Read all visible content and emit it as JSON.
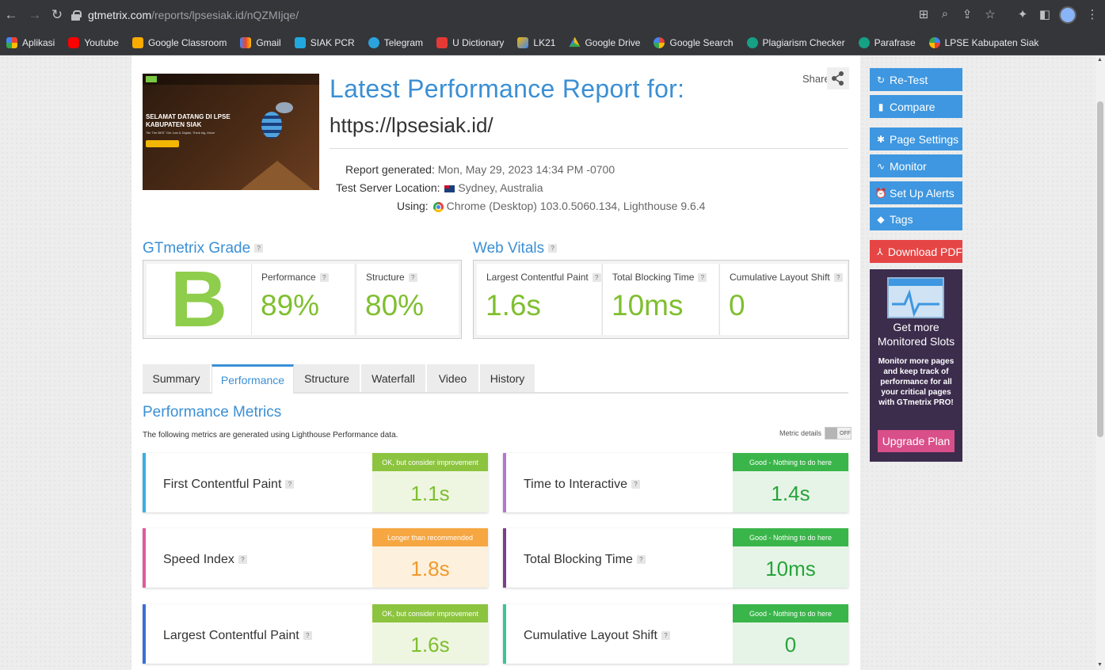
{
  "browser": {
    "url_host": "gtmetrix.com",
    "url_path": "/reports/lpsesiak.id/nQZMIjqe/",
    "bookmarks": [
      {
        "label": "Aplikasi",
        "color": "#e8453c"
      },
      {
        "label": "Youtube",
        "color": "#ff0000"
      },
      {
        "label": "Google Classroom",
        "color": "#f9ab00"
      },
      {
        "label": "Gmail",
        "color": "#ea4335"
      },
      {
        "label": "SIAK PCR",
        "color": "#21a8e0"
      },
      {
        "label": "Telegram",
        "color": "#2aa3de"
      },
      {
        "label": "U Dictionary",
        "color": "#e53935"
      },
      {
        "label": "LK21",
        "color": "#f4b400"
      },
      {
        "label": "Google Drive",
        "color": "#34a853"
      },
      {
        "label": "Google Search",
        "color": "#4285f4"
      },
      {
        "label": "Plagiarism Checker",
        "color": "#16a085"
      },
      {
        "label": "Parafrase",
        "color": "#16a085"
      },
      {
        "label": "LPSE Kabupaten Siak",
        "color": "#4285f4"
      }
    ]
  },
  "thumbnail": {
    "title": "SELAMAT DATANG DI LPSE KABUPATEN SIAK",
    "subtitle": "\"Be The BEE\" Get Just & Digital, Think big, Move"
  },
  "report": {
    "title": "Latest Performance Report for:",
    "url": "https://lpsesiak.id/",
    "share_label": "Share",
    "generated_label": "Report generated:",
    "generated_value": "Mon, May 29, 2023 14:34 PM -0700",
    "location_label": "Test Server Location:",
    "location_value": "Sydney, Australia",
    "using_label": "Using:",
    "using_value": "Chrome (Desktop) 103.0.5060.134, Lighthouse 9.6.4"
  },
  "grade": {
    "title": "GTmetrix Grade",
    "letter": "B",
    "performance_label": "Performance",
    "performance_value": "89%",
    "structure_label": "Structure",
    "structure_value": "80%"
  },
  "web_vitals": {
    "title": "Web Vitals",
    "items": [
      {
        "label": "Largest Contentful Paint",
        "value": "1.6s"
      },
      {
        "label": "Total Blocking Time",
        "value": "10ms"
      },
      {
        "label": "Cumulative Layout Shift",
        "value": "0"
      }
    ]
  },
  "tabs": [
    "Summary",
    "Performance",
    "Structure",
    "Waterfall",
    "Video",
    "History"
  ],
  "metrics_section": {
    "title": "Performance Metrics",
    "description": "The following metrics are generated using Lighthouse Performance data.",
    "metric_details_label": "Metric details",
    "toggle_state": "OFF"
  },
  "metrics": [
    {
      "label": "First Contentful Paint",
      "badge": "OK, but consider improvement",
      "value": "1.1s",
      "stripe": "#3aaee3",
      "badge_color": "#8cc43f",
      "bg": "#eef6e1",
      "text_color": "#7fbf2f"
    },
    {
      "label": "Time to Interactive",
      "badge": "Good - Nothing to do here",
      "value": "1.4s",
      "stripe": "#b376d6",
      "badge_color": "#3ab54a",
      "bg": "#e6f4e7",
      "text_color": "#27a43a"
    },
    {
      "label": "Speed Index",
      "badge": "Longer than recommended",
      "value": "1.8s",
      "stripe": "#e05a9a",
      "badge_color": "#f6a742",
      "bg": "#fdf0dc",
      "text_color": "#f09a2d"
    },
    {
      "label": "Total Blocking Time",
      "badge": "Good - Nothing to do here",
      "value": "10ms",
      "stripe": "#7a3f8a",
      "badge_color": "#3ab54a",
      "bg": "#e6f4e7",
      "text_color": "#27a43a"
    },
    {
      "label": "Largest Contentful Paint",
      "badge": "OK, but consider improvement",
      "value": "1.6s",
      "stripe": "#3a6fd4",
      "badge_color": "#8cc43f",
      "bg": "#eef6e1",
      "text_color": "#7fbf2f"
    },
    {
      "label": "Cumulative Layout Shift",
      "badge": "Good - Nothing to do here",
      "value": "0",
      "stripe": "#3bc49a",
      "badge_color": "#3ab54a",
      "bg": "#e6f4e7",
      "text_color": "#27a43a"
    }
  ],
  "sidebar": {
    "retest": "Re-Test",
    "compare": "Compare",
    "page_settings": "Page Settings",
    "monitor": "Monitor",
    "alerts": "Set Up Alerts",
    "tags": "Tags",
    "download_pdf": "Download PDF"
  },
  "promo": {
    "heading": "Get more Monitored Slots",
    "body": "Monitor more pages and keep track of performance for all your critical pages with GTmetrix PRO!",
    "button": "Upgrade Plan"
  }
}
